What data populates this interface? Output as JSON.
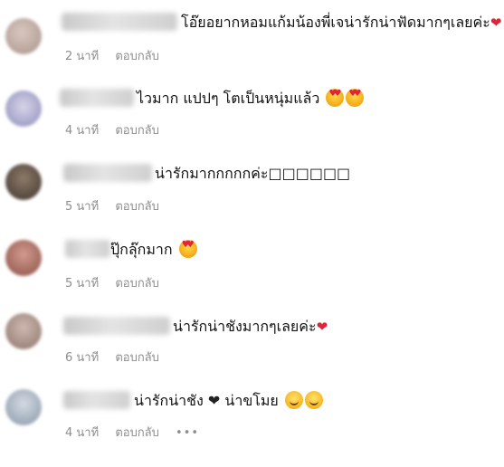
{
  "meta": {
    "reply_label": "ตอบกลับ",
    "more_label": "•••"
  },
  "comments": [
    {
      "text": "โอ๊ยอยากหอมแก้มน้องพี่เจน่ารักน่าฟัดมากๆเลยค่ะ",
      "time": "2 นาที",
      "suffix_icon": "red-heart",
      "avatar_color": "#b7a49a"
    },
    {
      "text": "ไวมาก แปปๆ โตเป็นหนุ่มแล้ว",
      "time": "4 นาที",
      "suffix_icon": "heart-eyes x2",
      "avatar_color": "#8f8fb8"
    },
    {
      "text": "น่ารักมากกกกกค่ะ□□□□□□",
      "time": "5 นาที",
      "avatar_color": "#6b5a4c"
    },
    {
      "text": "ปุ๊กลุ๊กมาก",
      "time": "5 นาที",
      "suffix_icon": "heart-eyes",
      "avatar_color": "#b07a6c"
    },
    {
      "text": "น่ารักน่าชังมากๆเลยค่ะ",
      "time": "6 นาที",
      "suffix_icon": "red-heart",
      "avatar_color": "#a98f85"
    },
    {
      "text": "น่ารักน่าชัง",
      "text2": "น่าขโมย",
      "time": "4 นาที",
      "suffix_icon": "black-heart, blush x2",
      "avatar_color": "#9aa7b4"
    }
  ]
}
